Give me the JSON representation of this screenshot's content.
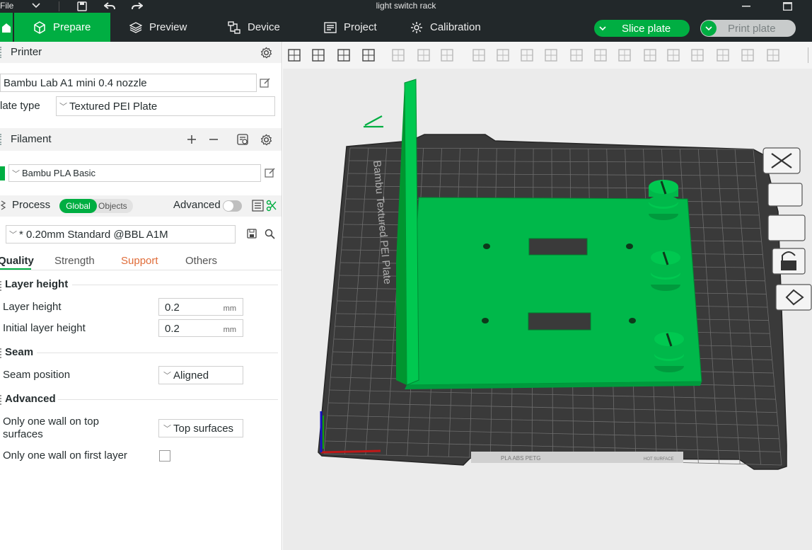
{
  "titlebar": {
    "file_label": "File",
    "window_title": "light switch rack"
  },
  "nav": {
    "tabs": [
      {
        "label": "Prepare",
        "icon": "cube-icon",
        "active": true
      },
      {
        "label": "Preview",
        "icon": "layers-icon",
        "active": false
      },
      {
        "label": "Device",
        "icon": "device-icon",
        "active": false
      },
      {
        "label": "Project",
        "icon": "project-icon",
        "active": false
      },
      {
        "label": "Calibration",
        "icon": "calibration-icon",
        "active": false
      }
    ],
    "slice_plate_label": "Slice plate",
    "print_plate_label": "Print plate"
  },
  "sidebar": {
    "printer": {
      "section_label": "Printer",
      "printer_name": "Bambu Lab A1 mini 0.4 nozzle",
      "plate_type_label": "late type",
      "plate_type_value": "Textured PEI Plate"
    },
    "filament": {
      "section_label": "Filament",
      "filament_name": "Bambu PLA Basic",
      "color": "#00ae42"
    },
    "process": {
      "section_label": "Process",
      "toggle_global": "Global",
      "toggle_objects": "Objects",
      "advanced_label": "Advanced",
      "profile": "* 0.20mm Standard @BBL A1M",
      "tabs": [
        {
          "label": "Quality",
          "selected": true
        },
        {
          "label": "Strength",
          "selected": false
        },
        {
          "label": "Support",
          "selected": false
        },
        {
          "label": "Others",
          "selected": false
        }
      ],
      "groups": {
        "layer_height": {
          "title": "Layer height",
          "layer_height_label": "Layer height",
          "layer_height_value": "0.2",
          "layer_height_unit": "mm",
          "initial_layer_height_label": "Initial layer height",
          "initial_layer_height_value": "0.2",
          "initial_layer_height_unit": "mm"
        },
        "seam": {
          "title": "Seam",
          "seam_position_label": "Seam position",
          "seam_position_value": "Aligned"
        },
        "advanced": {
          "title": "Advanced",
          "one_wall_top_label_line1": "Only one wall on top",
          "one_wall_top_label_line2": "surfaces",
          "one_wall_top_value": "Top surfaces",
          "one_wall_first_label": "Only one wall on first layer",
          "one_wall_first_checked": false
        }
      }
    }
  },
  "viewport": {
    "plate_text": "Bambu Textured PEI Plate",
    "plate_bottom_text": "PLA ABS PETG",
    "plate_bottom_text2": "HOT SURFACE",
    "model_color": "#00ae42",
    "bed_color": "#3c3c3c"
  }
}
